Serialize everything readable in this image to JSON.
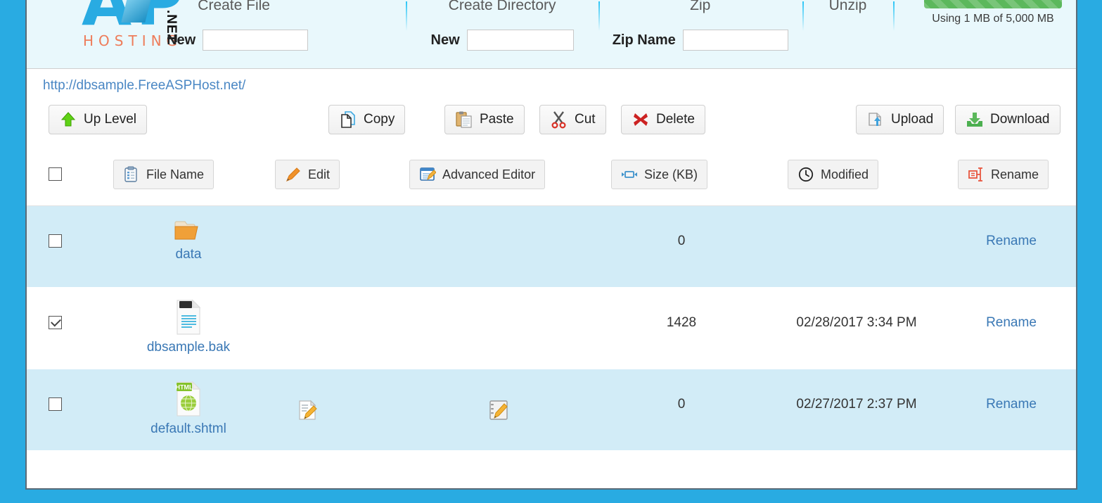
{
  "brand": {
    "logo_main": "AP",
    "logo_sub": "HOSTING",
    "logo_tld": ".NET"
  },
  "storage": {
    "text": "Using 1 MB of 5,000 MB",
    "percent": 100,
    "bar_color": "#5cb85c"
  },
  "topbar": {
    "panels": [
      {
        "title": "Create File",
        "label": "New",
        "value": "",
        "placeholder": ""
      },
      {
        "title": "Create Directory",
        "label": "New",
        "value": "",
        "placeholder": ""
      },
      {
        "title": "Zip",
        "label": "Zip Name",
        "value": "",
        "placeholder": ""
      },
      {
        "title": "Unzip",
        "label": "",
        "value": "",
        "placeholder": ""
      }
    ]
  },
  "breadcrumb": {
    "url": "http://dbsample.FreeASPHost.net/"
  },
  "toolbar": {
    "up_level": "Up Level",
    "copy": "Copy",
    "paste": "Paste",
    "cut": "Cut",
    "delete": "Delete",
    "upload": "Upload",
    "download": "Download"
  },
  "columns": {
    "file_name": "File Name",
    "edit": "Edit",
    "advanced_editor": "Advanced Editor",
    "size": "Size (KB)",
    "modified": "Modified",
    "rename": "Rename"
  },
  "files": [
    {
      "name": "data",
      "type": "folder",
      "checked": false,
      "edit": false,
      "advanced_editor": false,
      "size": "0",
      "modified": "",
      "rename": "Rename"
    },
    {
      "name": "dbsample.bak",
      "type": "backup",
      "checked": true,
      "edit": false,
      "advanced_editor": false,
      "size": "1428",
      "modified": "02/28/2017 3:34 PM",
      "rename": "Rename"
    },
    {
      "name": "default.shtml",
      "type": "html",
      "checked": false,
      "edit": true,
      "advanced_editor": true,
      "size": "0",
      "modified": "02/27/2017 2:37 PM",
      "rename": "Rename"
    }
  ],
  "colors": {
    "page_background": "#29abe2",
    "panel_background": "#ffffff",
    "topband_background": "#e9f8fc",
    "row_alt_background": "#d2ecf7",
    "link": "#3a78b5"
  }
}
